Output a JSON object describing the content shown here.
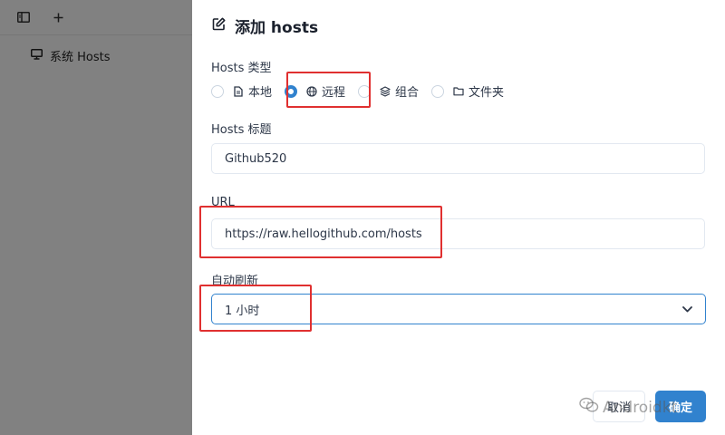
{
  "sidebar": {
    "toolbar": {
      "toggle_icon": "sidebar-toggle-icon",
      "add_icon": "plus-icon"
    },
    "items": [
      {
        "label": "系统 Hosts",
        "icon": "monitor-icon"
      }
    ]
  },
  "drawer": {
    "title": "添加 hosts",
    "title_icon": "edit-icon",
    "hosts_type": {
      "label": "Hosts 类型",
      "options": [
        {
          "label": "本地",
          "icon": "file-icon",
          "checked": false
        },
        {
          "label": "远程",
          "icon": "globe-icon",
          "checked": true
        },
        {
          "label": "组合",
          "icon": "layers-icon",
          "checked": false
        },
        {
          "label": "文件夹",
          "icon": "folder-icon",
          "checked": false
        }
      ]
    },
    "hosts_title": {
      "label": "Hosts 标题",
      "value": "Github520"
    },
    "url": {
      "label": "URL",
      "value": "https://raw.hellogithub.com/hosts"
    },
    "auto_refresh": {
      "label": "自动刷新",
      "value": "1 小时"
    },
    "buttons": {
      "cancel": "取消",
      "ok": "确定"
    }
  },
  "watermark": "Androidkt",
  "colors": {
    "accent": "#3182ce",
    "annotation": "#e03030",
    "overlay": "rgba(0,0,0,0.48)"
  }
}
